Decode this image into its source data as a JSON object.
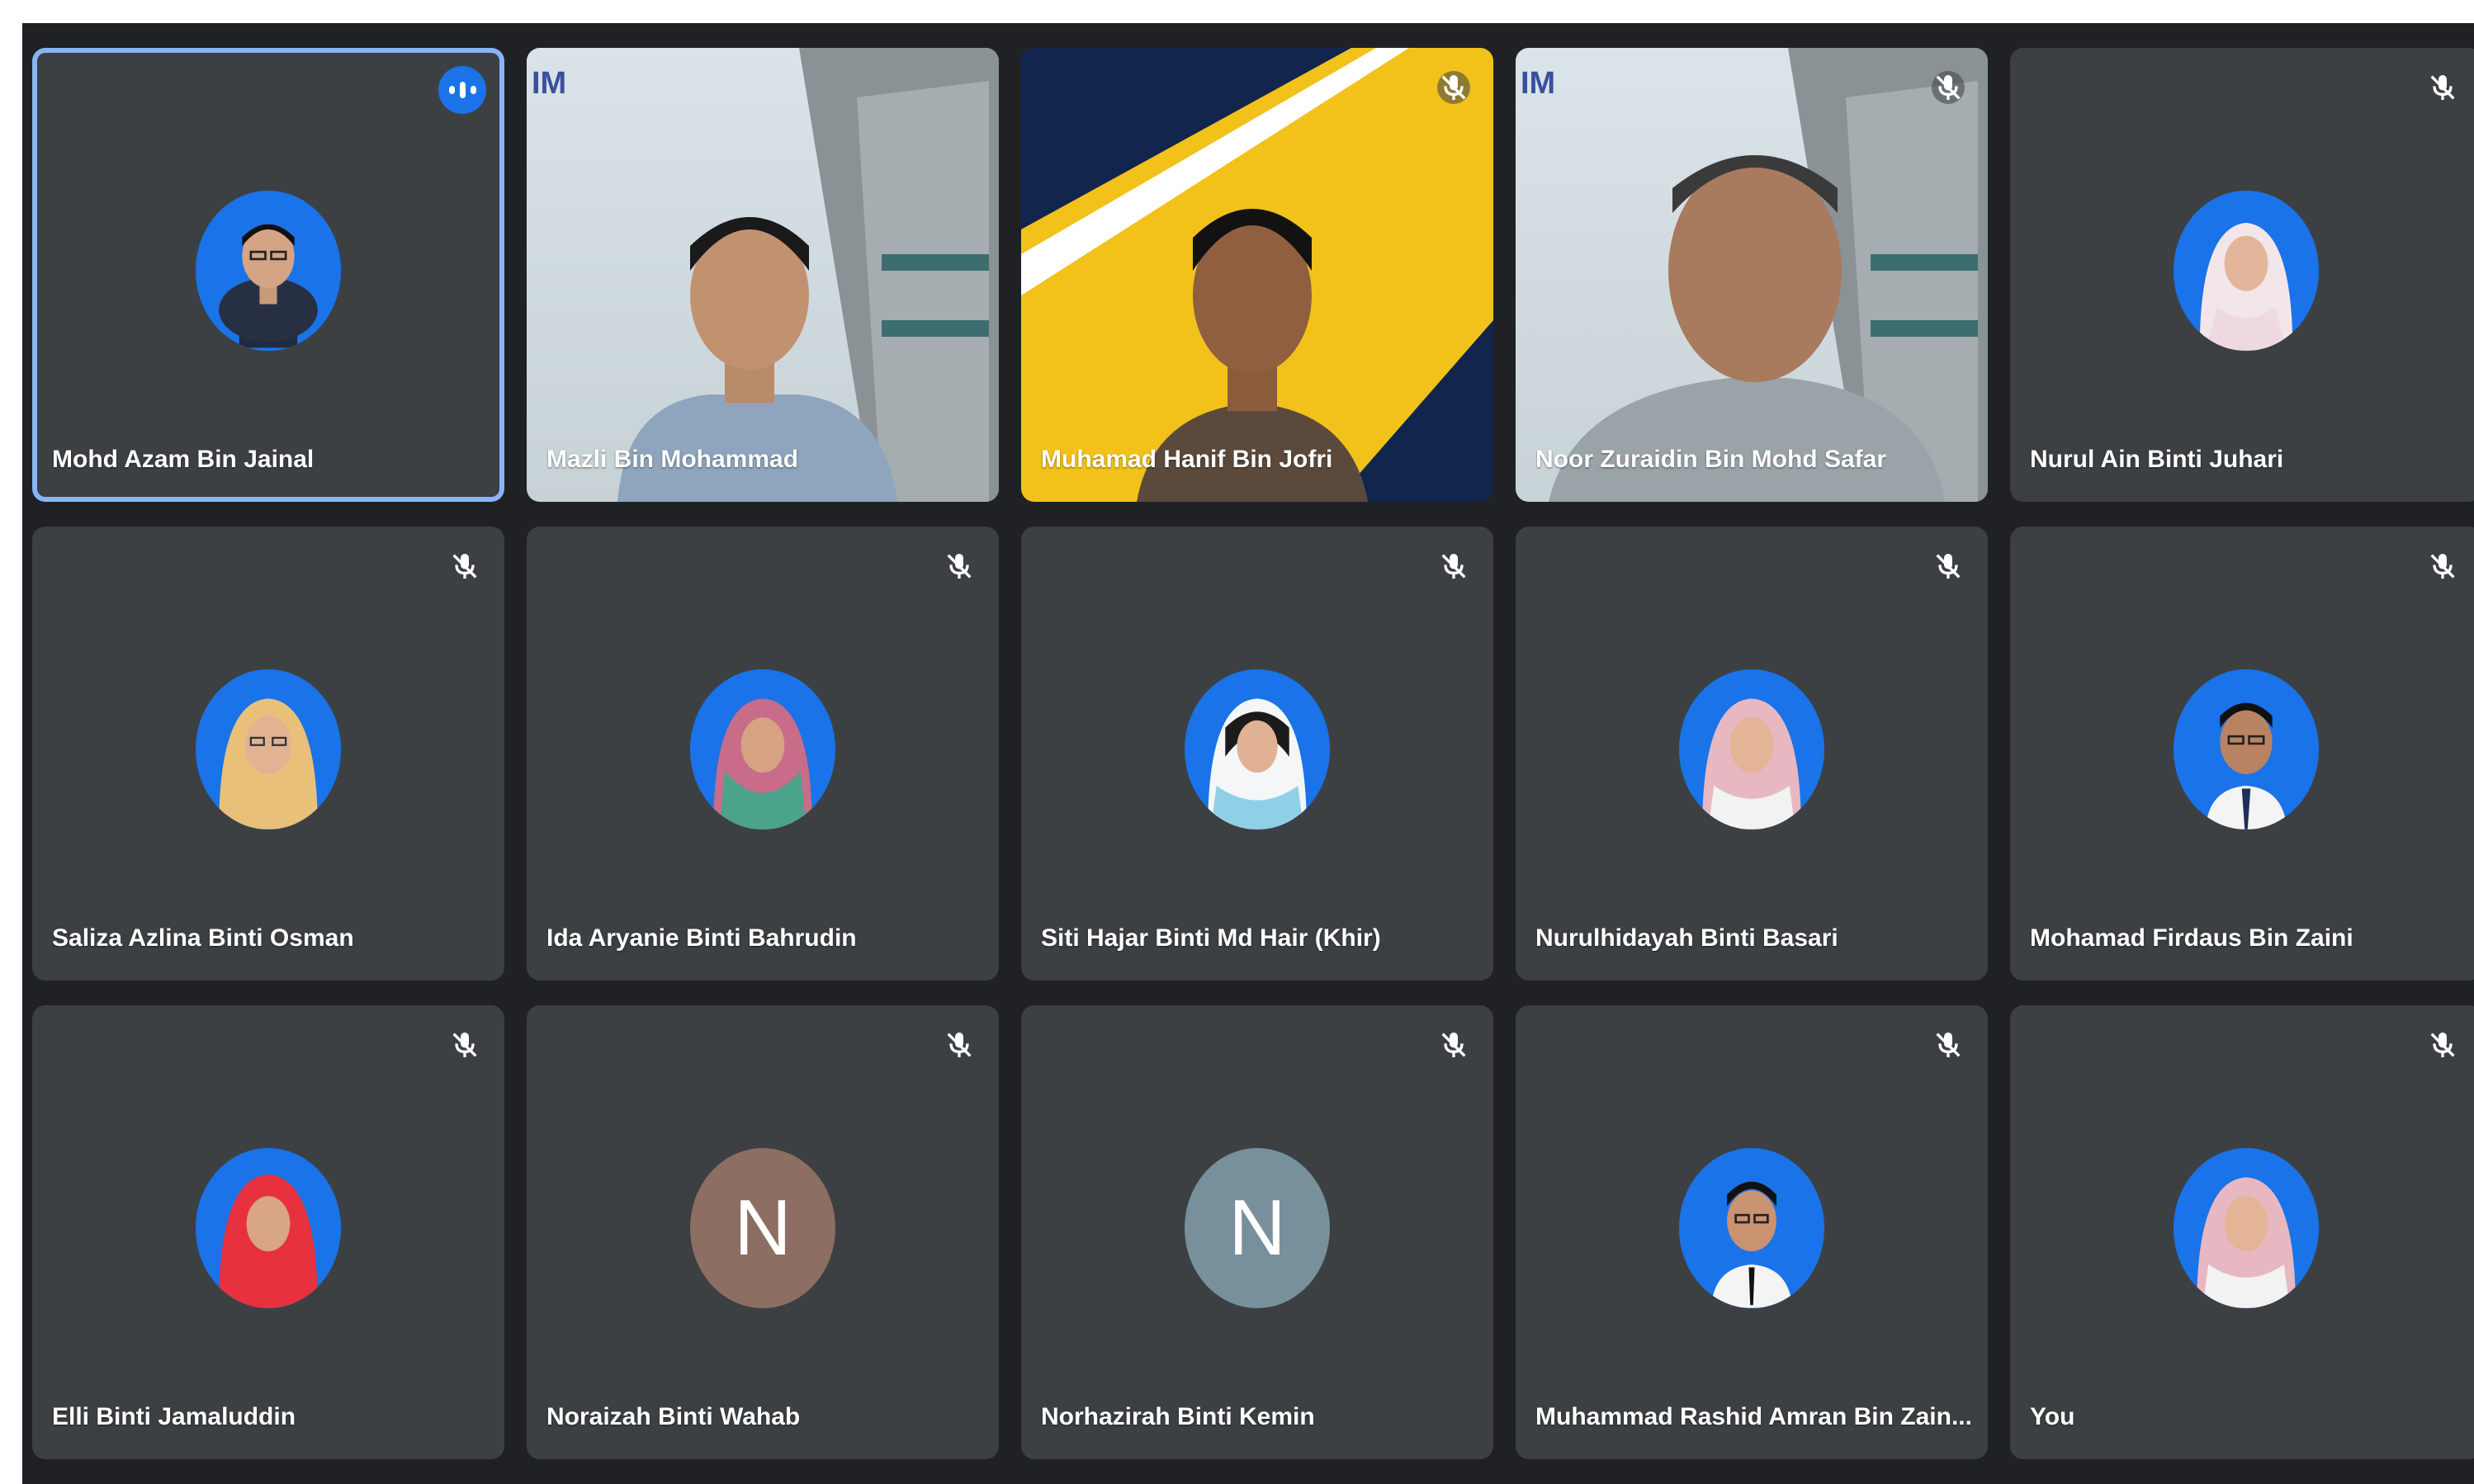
{
  "participants": [
    {
      "name": "Mohd Azam Bin Jainal",
      "type": "avatar",
      "speaking": true
    },
    {
      "name": "Mazli Bin Mohammad",
      "type": "video",
      "logo": "IM"
    },
    {
      "name": "Muhamad Hanif Bin Jofri",
      "type": "video"
    },
    {
      "name": "Noor Zuraidin Bin Mohd Safar",
      "type": "video",
      "logo": "IM"
    },
    {
      "name": "Nurul Ain Binti Juhari",
      "type": "avatar"
    },
    {
      "name": "Saliza Azlina Binti Osman",
      "type": "avatar"
    },
    {
      "name": "Ida Aryanie Binti Bahrudin",
      "type": "avatar"
    },
    {
      "name": "Siti Hajar Binti Md Hair (Khir)",
      "type": "avatar"
    },
    {
      "name": "Nurulhidayah Binti Basari",
      "type": "avatar"
    },
    {
      "name": "Mohamad Firdaus Bin Zaini",
      "type": "avatar"
    },
    {
      "name": "Elli Binti Jamaluddin",
      "type": "avatar"
    },
    {
      "name": "Noraizah Binti Wahab",
      "type": "initial",
      "initial": "N",
      "color": "#8d6e63"
    },
    {
      "name": "Norhazirah Binti Kemin",
      "type": "initial",
      "initial": "N",
      "color": "#78909c"
    },
    {
      "name": "Muhammad Rashid Amran Bin Zain...",
      "type": "avatar"
    },
    {
      "name": "You",
      "type": "avatar"
    }
  ],
  "icons": {
    "muted": "mic-off-icon",
    "speaking": "audio-level-icon"
  },
  "colors": {
    "background": "#202124",
    "tile": "#3c4043",
    "speaking_border": "#8ab4f8",
    "avatar_bg": "#1a73e8"
  }
}
